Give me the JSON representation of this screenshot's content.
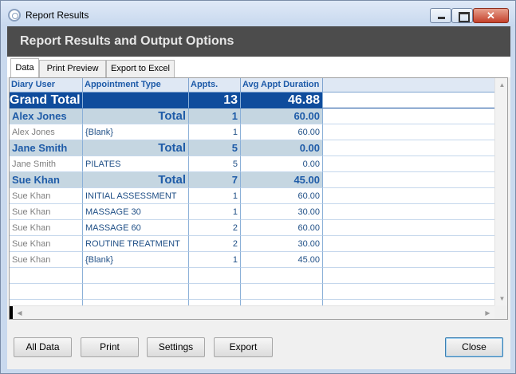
{
  "window": {
    "title": "Report Results"
  },
  "header": {
    "title": "Report Results and Output Options"
  },
  "tabs": [
    {
      "label": "Data",
      "active": true
    },
    {
      "label": "Print Preview",
      "active": false
    },
    {
      "label": "Export to Excel",
      "active": false
    }
  ],
  "grid": {
    "columns": [
      "Diary User",
      "Appointment Type",
      "Appts.",
      "Avg Appt Duration"
    ],
    "grand_total": {
      "label": "Grand Total",
      "appts": "13",
      "avg": "46.88"
    },
    "rows": [
      {
        "kind": "subtotal",
        "user": "Alex Jones",
        "type": "Total",
        "appts": "1",
        "avg": "60.00"
      },
      {
        "kind": "detail",
        "user": "Alex Jones",
        "type": "{Blank}",
        "appts": "1",
        "avg": "60.00"
      },
      {
        "kind": "subtotal",
        "user": "Jane Smith",
        "type": "Total",
        "appts": "5",
        "avg": "0.00"
      },
      {
        "kind": "detail",
        "user": "Jane Smith",
        "type": "PILATES",
        "appts": "5",
        "avg": "0.00"
      },
      {
        "kind": "subtotal",
        "user": "Sue Khan",
        "type": "Total",
        "appts": "7",
        "avg": "45.00"
      },
      {
        "kind": "detail",
        "user": "Sue Khan",
        "type": "INITIAL ASSESSMENT",
        "appts": "1",
        "avg": "60.00"
      },
      {
        "kind": "detail",
        "user": "Sue Khan",
        "type": "MASSAGE 30",
        "appts": "1",
        "avg": "30.00"
      },
      {
        "kind": "detail",
        "user": "Sue Khan",
        "type": "MASSAGE 60",
        "appts": "2",
        "avg": "60.00"
      },
      {
        "kind": "detail",
        "user": "Sue Khan",
        "type": "ROUTINE TREATMENT",
        "appts": "2",
        "avg": "30.00"
      },
      {
        "kind": "detail",
        "user": "Sue Khan",
        "type": "{Blank}",
        "appts": "1",
        "avg": "45.00"
      }
    ]
  },
  "buttons": {
    "all_data": "All Data",
    "print": "Print",
    "settings": "Settings",
    "export": "Export",
    "close": "Close"
  },
  "colors": {
    "grand_total_bg": "#0f4c9c",
    "subtotal_bg": "#c5d6e1",
    "header_band": "#4c4c4c",
    "header_text": "#1d5aa8"
  }
}
